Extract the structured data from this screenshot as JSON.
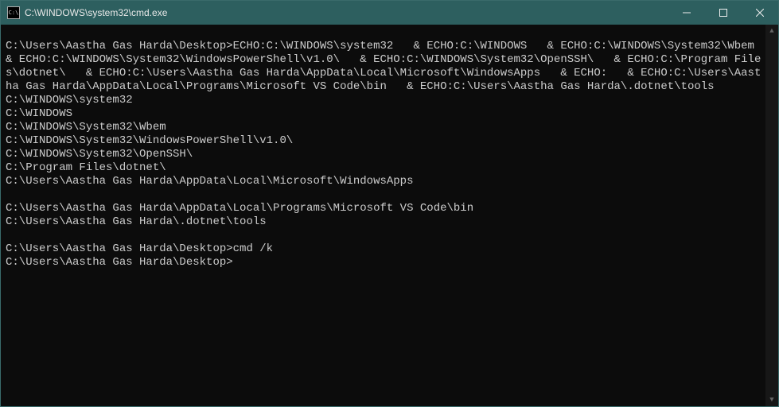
{
  "window": {
    "title": "C:\\WINDOWS\\system32\\cmd.exe",
    "icon_label": "C:\\"
  },
  "terminal": {
    "lines": [
      "",
      "C:\\Users\\Aastha Gas Harda\\Desktop>ECHO:C:\\WINDOWS\\system32   & ECHO:C:\\WINDOWS   & ECHO:C:\\WINDOWS\\System32\\Wbem   & ECHO:C:\\WINDOWS\\System32\\WindowsPowerShell\\v1.0\\   & ECHO:C:\\WINDOWS\\System32\\OpenSSH\\   & ECHO:C:\\Program Files\\dotnet\\   & ECHO:C:\\Users\\Aastha Gas Harda\\AppData\\Local\\Microsoft\\WindowsApps   & ECHO:   & ECHO:C:\\Users\\Aastha Gas Harda\\AppData\\Local\\Programs\\Microsoft VS Code\\bin   & ECHO:C:\\Users\\Aastha Gas Harda\\.dotnet\\tools",
      "C:\\WINDOWS\\system32",
      "C:\\WINDOWS",
      "C:\\WINDOWS\\System32\\Wbem",
      "C:\\WINDOWS\\System32\\WindowsPowerShell\\v1.0\\",
      "C:\\WINDOWS\\System32\\OpenSSH\\",
      "C:\\Program Files\\dotnet\\",
      "C:\\Users\\Aastha Gas Harda\\AppData\\Local\\Microsoft\\WindowsApps",
      "",
      "C:\\Users\\Aastha Gas Harda\\AppData\\Local\\Programs\\Microsoft VS Code\\bin",
      "C:\\Users\\Aastha Gas Harda\\.dotnet\\tools",
      "",
      "C:\\Users\\Aastha Gas Harda\\Desktop>cmd /k",
      "C:\\Users\\Aastha Gas Harda\\Desktop>"
    ]
  },
  "controls": {
    "minimize": "Minimize",
    "maximize": "Maximize",
    "close": "Close"
  }
}
